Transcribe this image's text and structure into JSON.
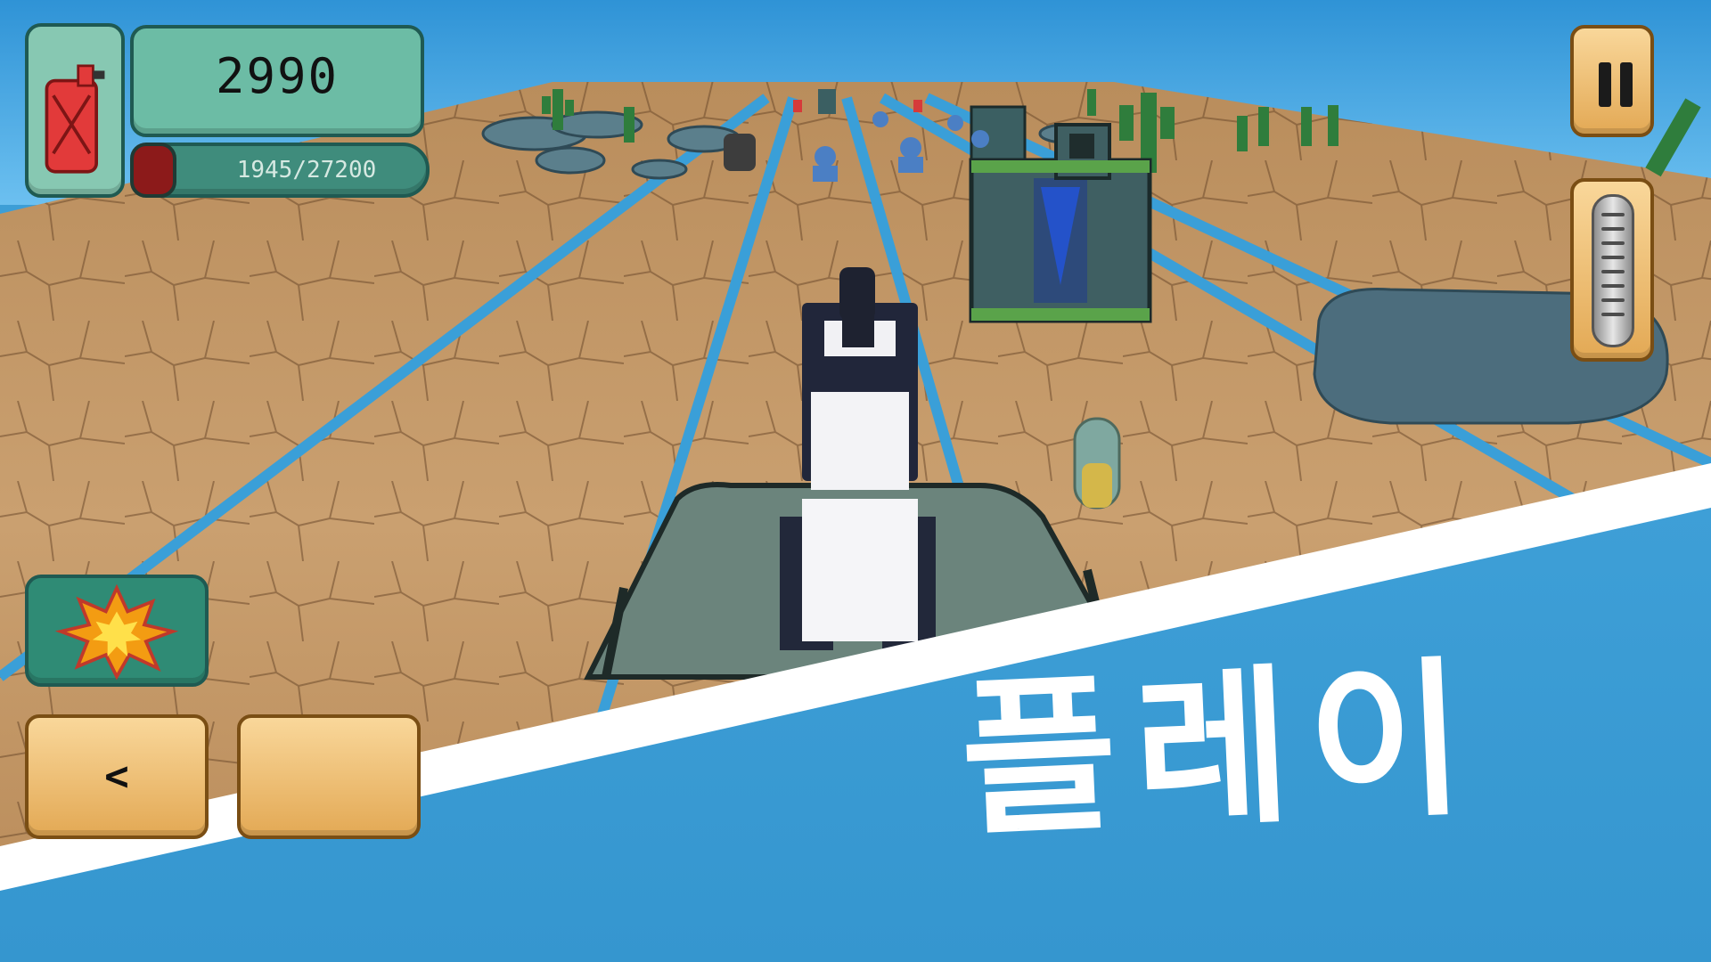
{
  "hud": {
    "fuel_icon": "fuel-can-icon",
    "score": "2990",
    "progress_text": "1945/27200",
    "pause_icon": "pause-icon",
    "accelerator_icon": "gas-pedal-icon",
    "bomb_icon": "explosion-icon",
    "left_label": "<"
  },
  "banner": {
    "label": "플레이",
    "color": "#3d9ed6"
  },
  "colors": {
    "sky": "#4aa8e2",
    "ground": "#c99a68",
    "lane": "#3a9fd8",
    "hud_green": "#5fae9a",
    "button_tan": "#f3c47b"
  }
}
